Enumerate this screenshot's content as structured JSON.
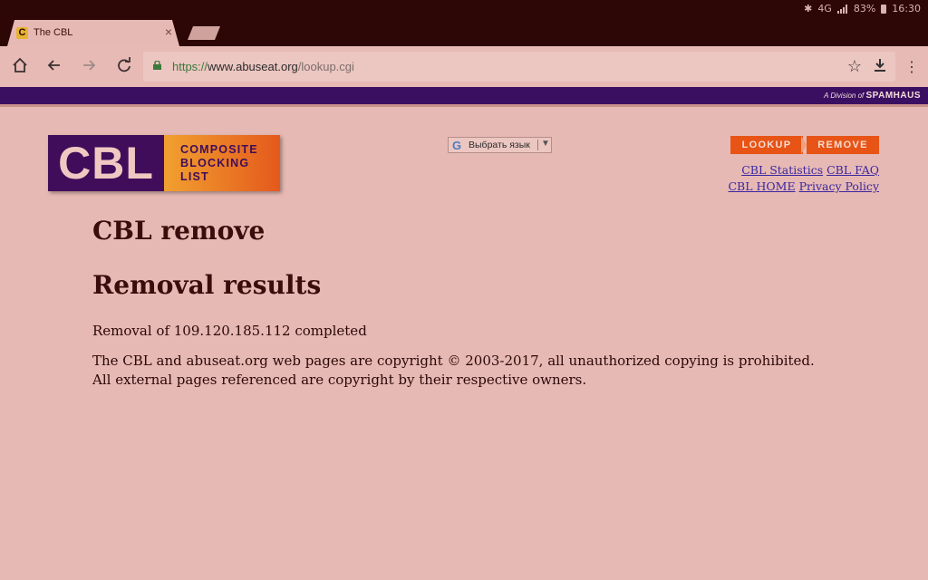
{
  "status_bar": {
    "battery": "83%",
    "time": "16:30",
    "network": "4G"
  },
  "tab": {
    "title": "The CBL",
    "favicon": "C"
  },
  "address_bar": {
    "scheme": "https://",
    "host": "www.abuseat.org",
    "path": "/lookup.cgi"
  },
  "header": {
    "division_prefix": "A Division of",
    "division_brand": "SPAMHAUS",
    "logo_short": "CBL",
    "logo_lines": [
      "COMPOSITE",
      "BLOCKING",
      "LIST"
    ],
    "translate_label": "Выбрать язык",
    "lookup_label": "LOOKUP",
    "remove_label": "REMOVE",
    "links": {
      "stats": "CBL Statistics",
      "faq": "CBL FAQ",
      "home": "CBL HOME",
      "privacy": "Privacy Policy"
    }
  },
  "main": {
    "title": "CBL remove",
    "subtitle": "Removal results",
    "result": "Removal of 109.120.185.112 completed",
    "copyright": "The CBL and abuseat.org web pages are copyright © 2003-2017, all unauthorized copying is prohibited. All external pages referenced are copyright by their respective owners."
  },
  "colors": {
    "page_bg": "#e7b9b4",
    "spamhaus_bar": "#3a0f62",
    "accent_orange": "#e75415",
    "link": "#3a27a0"
  }
}
